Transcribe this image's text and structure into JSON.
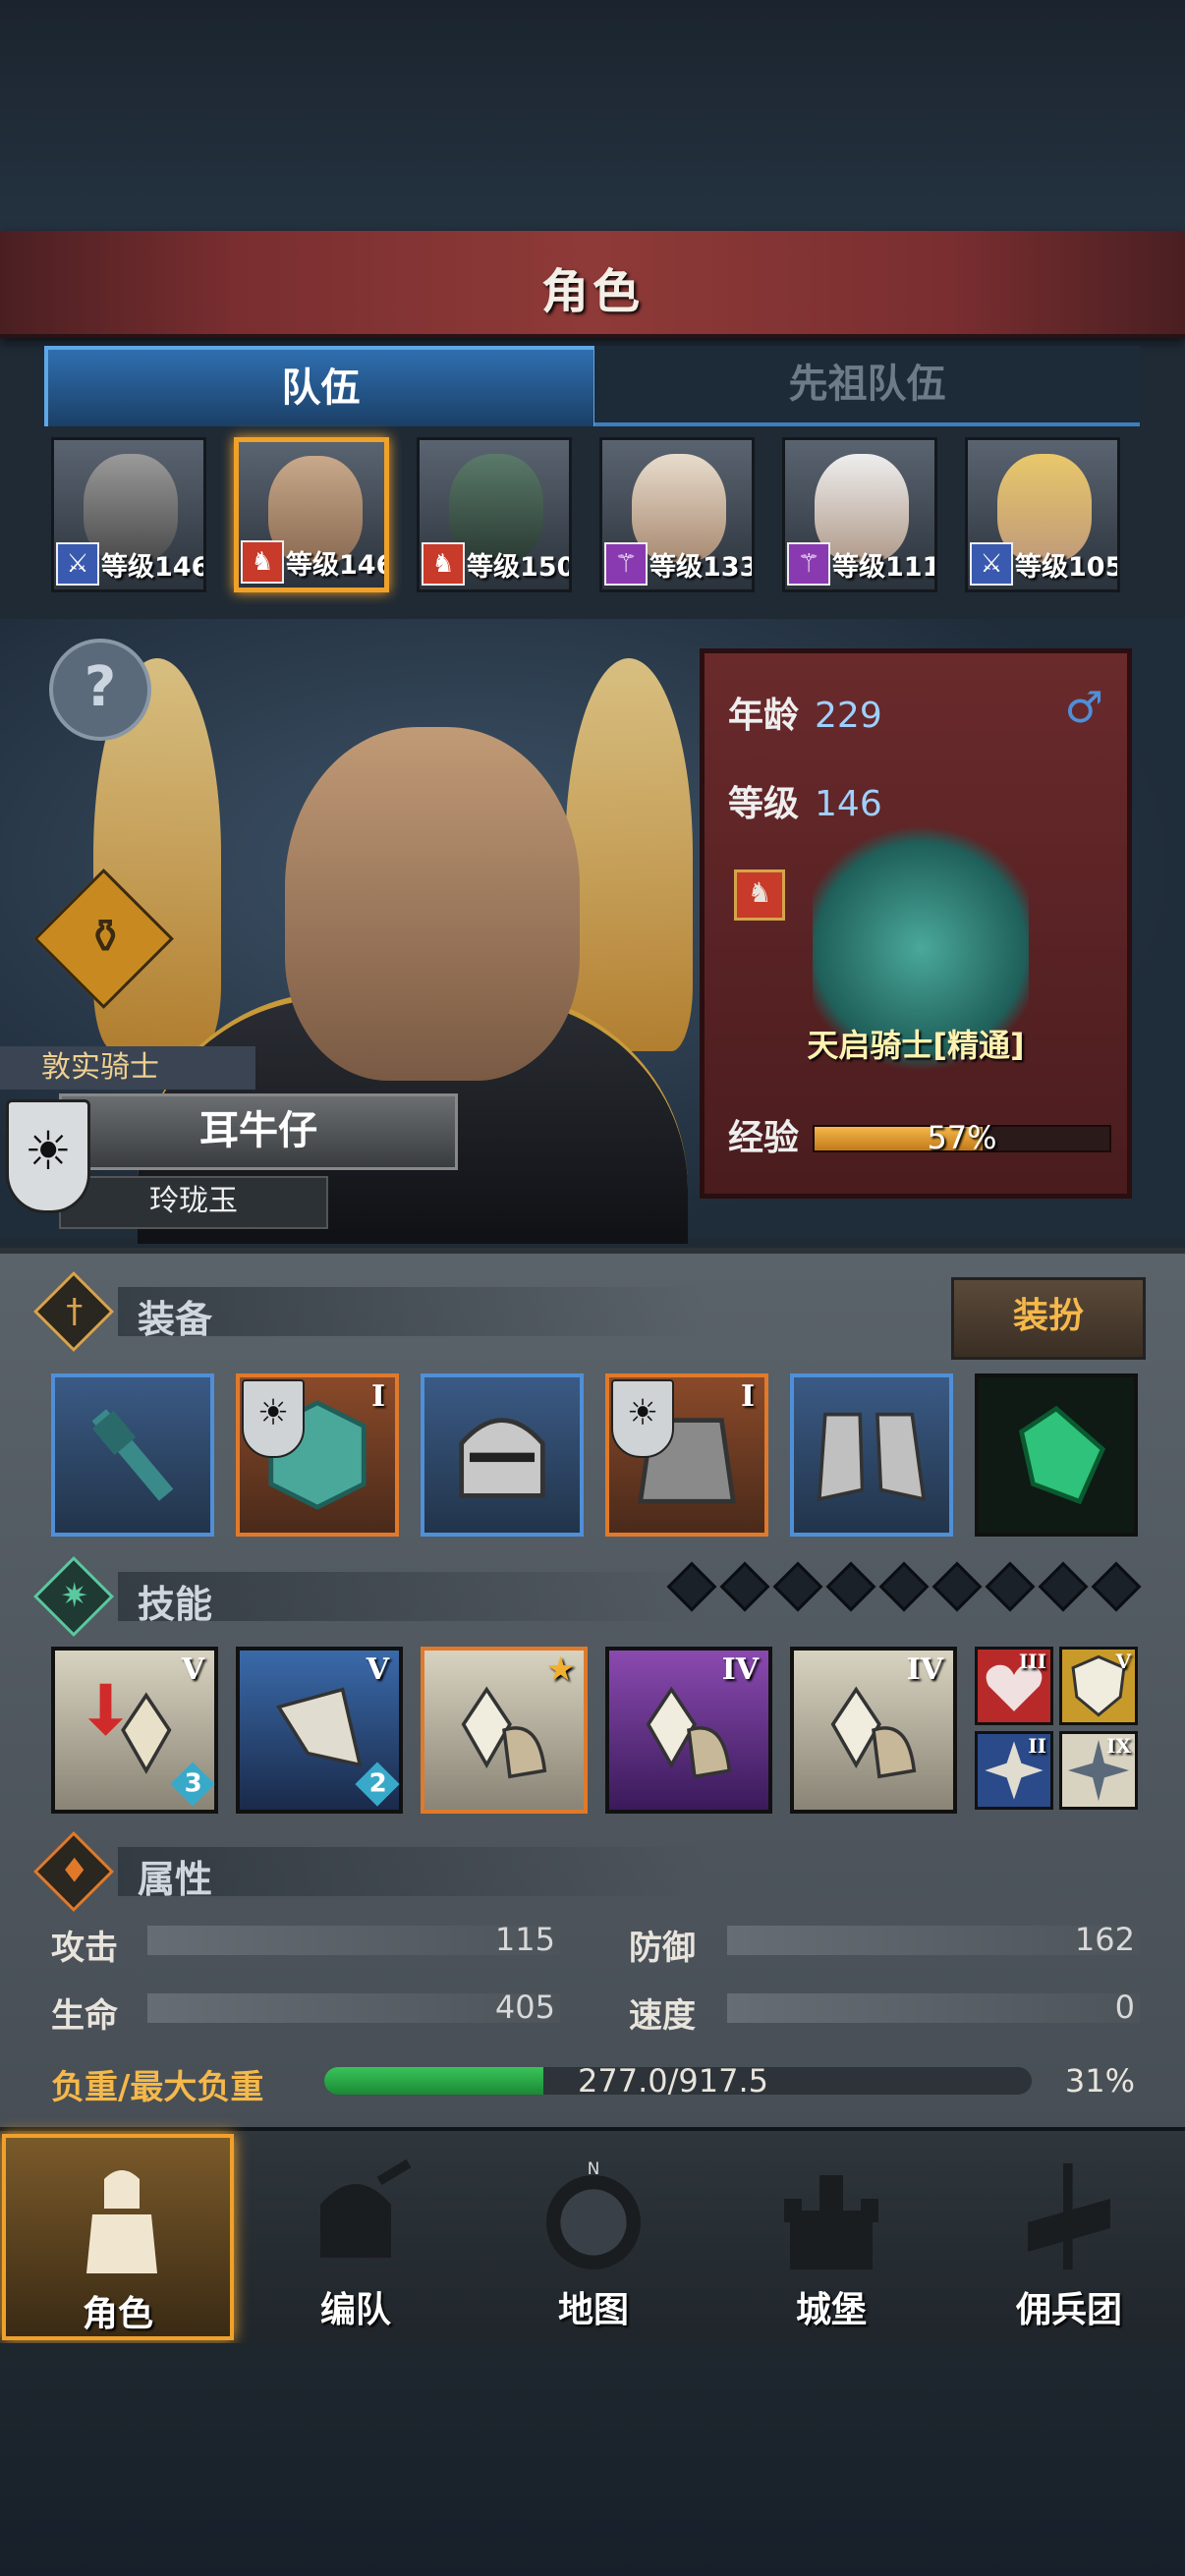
{
  "header": {
    "title": "角色"
  },
  "tabs": [
    {
      "label": "队伍"
    },
    {
      "label": "先祖队伍"
    }
  ],
  "team": [
    {
      "level": "等级146",
      "class_icon": "sword-icon"
    },
    {
      "level": "等级146",
      "class_icon": "horse-icon",
      "selected": true
    },
    {
      "level": "等级150",
      "class_icon": "horse-icon"
    },
    {
      "level": "等级133",
      "class_icon": "staff-icon"
    },
    {
      "level": "等级111",
      "class_icon": "staff-icon"
    },
    {
      "level": "等级105",
      "class_icon": "sword-icon"
    }
  ],
  "character": {
    "title": "敦实骑士",
    "name": "耳牛仔",
    "subname": "玲珑玉"
  },
  "info": {
    "age_label": "年龄",
    "age": "229",
    "level_label": "等级",
    "level": "146",
    "gender_symbol": "♂",
    "class_name": "天启骑士[精通]",
    "xp_label": "经验",
    "xp_percent": "57%",
    "xp_fraction": 0.57
  },
  "equipment": {
    "title": "装备",
    "dress_label": "装扮",
    "slots": [
      {
        "icon": "mace-icon",
        "rarity": "blue"
      },
      {
        "icon": "shield-icon",
        "rarity": "orange",
        "tier": "I"
      },
      {
        "icon": "helmet-icon",
        "rarity": "blue"
      },
      {
        "icon": "armor-icon",
        "rarity": "orange",
        "tier": "I"
      },
      {
        "icon": "boots-icon",
        "rarity": "blue"
      },
      {
        "icon": "crystal-icon",
        "rarity": "dark"
      }
    ]
  },
  "skills": {
    "title": "技能",
    "list": [
      {
        "icon": "crystal-heal-icon",
        "tier": "V",
        "count": "3"
      },
      {
        "icon": "sword-break-icon",
        "tier": "V",
        "count": "2"
      },
      {
        "icon": "crystal-star-icon"
      },
      {
        "icon": "crystal-purple-icon",
        "tier": "IV"
      },
      {
        "icon": "crystal-grey-icon",
        "tier": "IV"
      }
    ],
    "minis": [
      {
        "icon": "heart-icon",
        "tier": "III"
      },
      {
        "icon": "shield-icon",
        "tier": "V"
      },
      {
        "icon": "burst-icon",
        "tier": "II"
      },
      {
        "icon": "spark-icon",
        "tier": "IX"
      }
    ]
  },
  "attributes": {
    "title": "属性",
    "attack_label": "攻击",
    "attack": "115",
    "defense_label": "防御",
    "defense": "162",
    "hp_label": "生命",
    "hp": "405",
    "speed_label": "速度",
    "speed": "0",
    "load_label": "负重/最大负重",
    "load": "277.0/917.5",
    "load_percent": "31%",
    "load_fraction": 0.31
  },
  "nav": [
    {
      "label": "角色",
      "icon": "knight-icon"
    },
    {
      "label": "编队",
      "icon": "helmet-icon"
    },
    {
      "label": "地图",
      "icon": "compass-icon"
    },
    {
      "label": "城堡",
      "icon": "castle-icon"
    },
    {
      "label": "佣兵团",
      "icon": "banner-icon"
    }
  ],
  "colors": {
    "accent": "#f0a12a",
    "tab": "#2f6fb0",
    "panel": "#6a2a2c"
  }
}
